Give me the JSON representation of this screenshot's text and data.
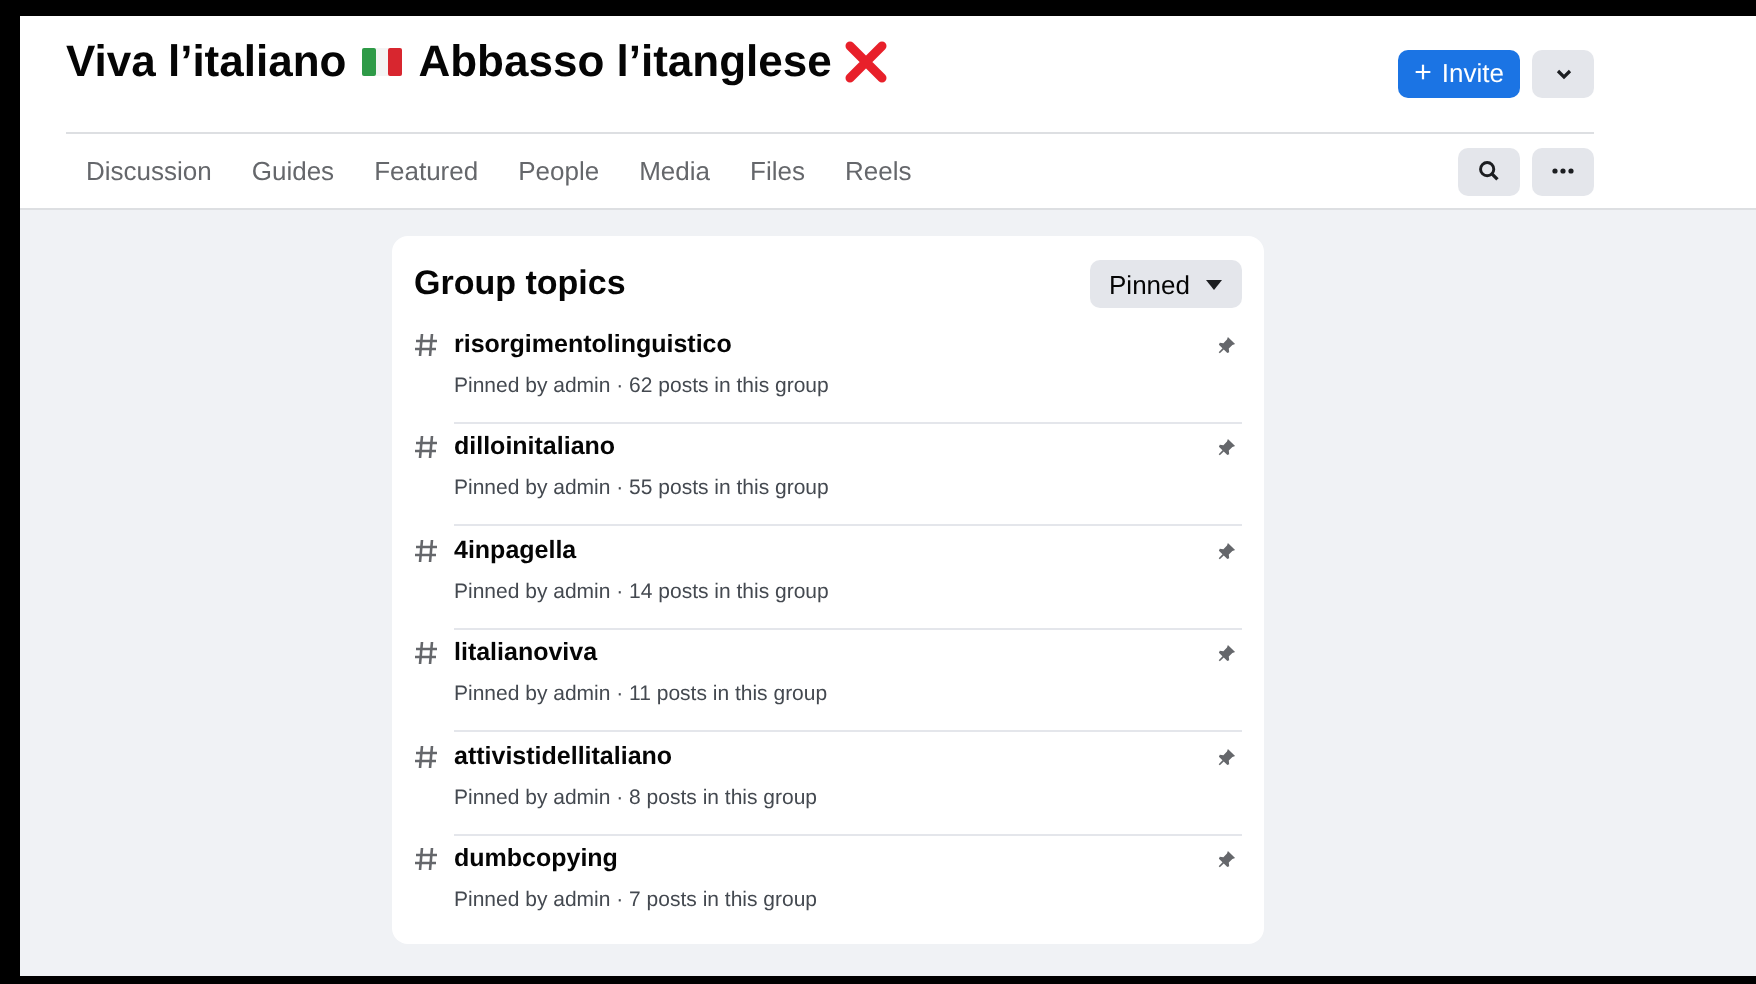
{
  "header": {
    "title_parts": [
      "Viva l’italiano",
      "Abbasso l’itanglese"
    ],
    "invite_button": {
      "icon": "+",
      "label": "Invite"
    }
  },
  "tabs": [
    {
      "label": "Discussion",
      "selected": false
    },
    {
      "label": "Guides",
      "selected": false
    },
    {
      "label": "Featured",
      "selected": false
    },
    {
      "label": "People",
      "selected": false
    },
    {
      "label": "Media",
      "selected": false
    },
    {
      "label": "Files",
      "selected": false
    },
    {
      "label": "Reels",
      "selected": false
    }
  ],
  "topics_card": {
    "title": "Group topics",
    "filter_button": "Pinned",
    "topics": [
      {
        "name": "risorgimentolinguistico",
        "meta": "Pinned by admin · 62 posts in this group",
        "pinned": true
      },
      {
        "name": "dilloinitaliano",
        "meta": "Pinned by admin · 55 posts in this group",
        "pinned": true
      },
      {
        "name": "4inpagella",
        "meta": "Pinned by admin · 14 posts in this group",
        "pinned": true
      },
      {
        "name": "litalianoviva",
        "meta": "Pinned by admin · 11 posts in this group",
        "pinned": true
      },
      {
        "name": "attivistidellitaliano",
        "meta": "Pinned by admin · 8 posts in this group",
        "pinned": true
      },
      {
        "name": "dumbcopying",
        "meta": "Pinned by admin · 7 posts in this group",
        "pinned": true
      }
    ]
  }
}
